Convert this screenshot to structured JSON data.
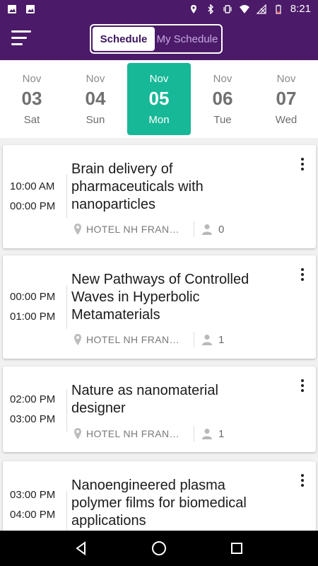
{
  "status_bar": {
    "time": "8:21",
    "left_icons": [
      "image-icon",
      "gallery-icon"
    ],
    "right_icons": [
      "location-icon",
      "bluetooth-icon",
      "vibrate-icon",
      "wifi-icon",
      "no-signal-icon",
      "battery-icon"
    ]
  },
  "app_bar": {
    "menu_icon": "hamburger-menu-icon",
    "segment": {
      "active_label": "Schedule",
      "inactive_label": "My Schedule"
    }
  },
  "dates": [
    {
      "month": "Nov",
      "day": "03",
      "weekday": "Sat",
      "selected": false
    },
    {
      "month": "Nov",
      "day": "04",
      "weekday": "Sun",
      "selected": false
    },
    {
      "month": "Nov",
      "day": "05",
      "weekday": "Mon",
      "selected": true
    },
    {
      "month": "Nov",
      "day": "06",
      "weekday": "Tue",
      "selected": false
    },
    {
      "month": "Nov",
      "day": "07",
      "weekday": "Wed",
      "selected": false
    }
  ],
  "sessions": [
    {
      "start": "10:00 AM",
      "end": "00:00 PM",
      "title": "Brain delivery of pharmaceuticals with nanoparticles",
      "location": "HOTEL NH FRANKFURT",
      "attendees": "0"
    },
    {
      "start": "00:00 PM",
      "end": "01:00 PM",
      "title": "New Pathways of Controlled Waves in Hyperbolic Metamaterials",
      "location": "HOTEL NH FRANKFURT",
      "attendees": "1"
    },
    {
      "start": "02:00 PM",
      "end": "03:00 PM",
      "title": "Nature as nanomaterial designer",
      "location": "HOTEL NH FRANKFURT",
      "attendees": "1"
    },
    {
      "start": "03:00 PM",
      "end": "04:00 PM",
      "title": "Nanoengineered plasma polymer films for biomedical applications",
      "location": "",
      "attendees": ""
    }
  ],
  "colors": {
    "primary": "#4b1a68",
    "accent": "#17b897"
  },
  "nav_bar": {
    "icons": [
      "back-triangle-icon",
      "home-circle-icon",
      "recents-square-icon"
    ]
  }
}
